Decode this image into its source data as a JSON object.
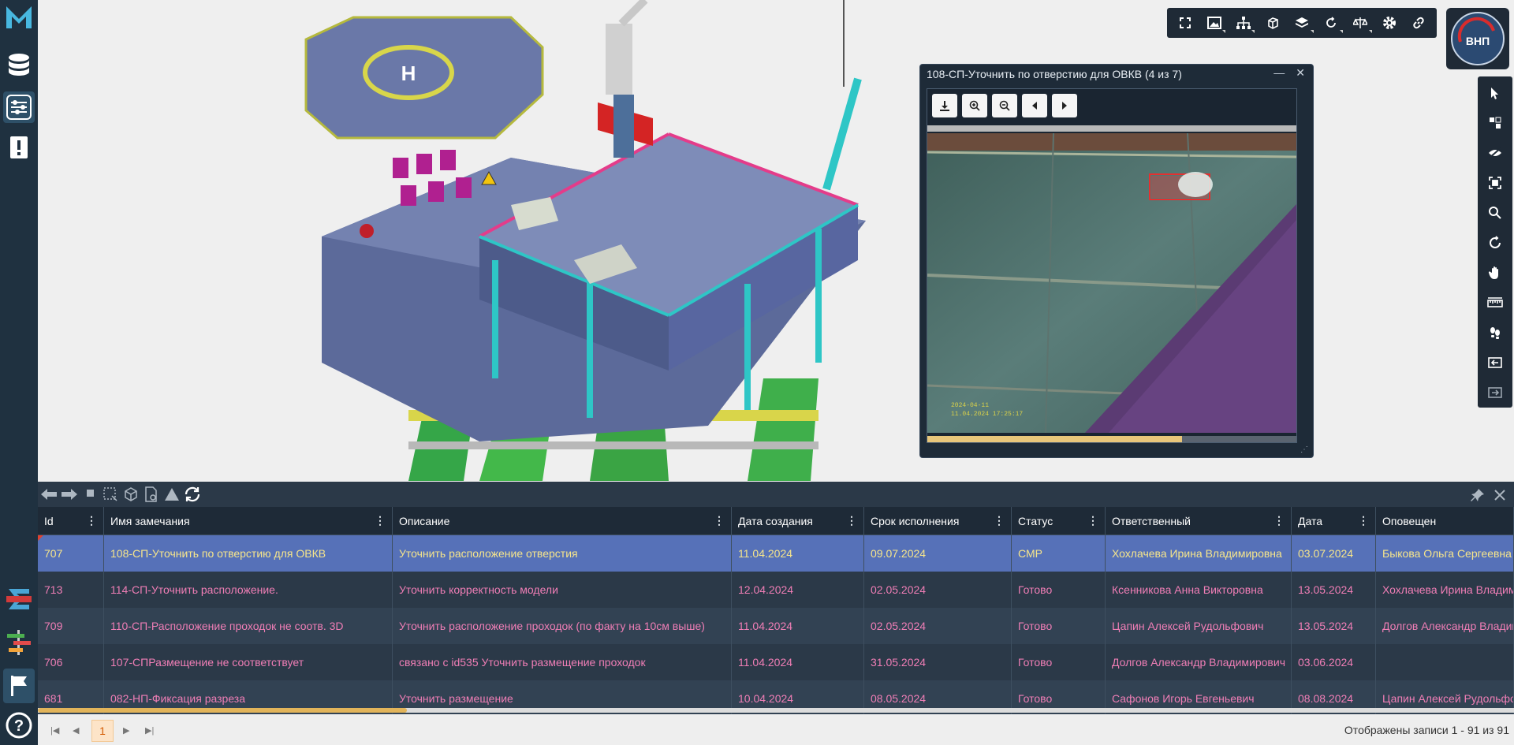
{
  "window": {
    "title": "108-СП-Уточнить по отверстию для ОВКВ (4 из 7)",
    "photo_stamp_line1": "2024-04-11",
    "photo_stamp_line2": "11.04.2024 17:25:17",
    "photo_progress": 0.69
  },
  "logo": {
    "text": "ВНП"
  },
  "sidebar": {
    "items": [
      {
        "icon": "logo-m-icon"
      },
      {
        "icon": "database-icon"
      },
      {
        "icon": "filter-sliders-icon"
      },
      {
        "icon": "issues-book-icon"
      },
      {
        "icon": "sigma-layers-icon"
      },
      {
        "icon": "gantt-icon"
      },
      {
        "icon": "flag-icon"
      },
      {
        "icon": "help-icon",
        "label": "?"
      }
    ]
  },
  "top_toolbar": {
    "items": [
      "fullscreen-icon",
      "image-icon",
      "hierarchy-icon",
      "cube-icon",
      "layers-icon",
      "rotate-icon",
      "scales-icon",
      "settings-icon",
      "link-icon"
    ]
  },
  "right_toolbar": {
    "items": [
      "select-cursor-icon",
      "select-box-icon",
      "hide-icon",
      "fit-view-icon",
      "search-zoom-icon",
      "orbit-icon",
      "pan-hand-icon",
      "measure-icon",
      "walk-icon",
      "section-in-icon",
      "section-out-icon"
    ]
  },
  "grid": {
    "columns": [
      "Id",
      "Имя замечания",
      "Описание",
      "Дата создания",
      "Срок исполнения",
      "Статус",
      "Ответственный",
      "Дата",
      "Оповещен"
    ],
    "rows": [
      [
        "707",
        "108-СП-Уточнить по отверстию для ОВКВ",
        "Уточнить расположение отверстия",
        "11.04.2024",
        "09.07.2024",
        "СМР",
        "Хохлачева Ирина Владимировна",
        "03.07.2024",
        "Быкова Ольга Сергеевна"
      ],
      [
        "713",
        "114-СП-Уточнить расположение.",
        "Уточнить корректность модели",
        "12.04.2024",
        "02.05.2024",
        "Готово",
        "Ксенникова Анна Викторовна",
        "13.05.2024",
        "Хохлачева Ирина Владимировна"
      ],
      [
        "709",
        "110-СП-Расположение проходок не соотв. 3D",
        "Уточнить расположение проходок (по факту на 10см выше)",
        "11.04.2024",
        "02.05.2024",
        "Готово",
        "Цапин Алексей Рудольфович",
        "13.05.2024",
        "Долгов Александр Владимирович"
      ],
      [
        "706",
        "107-СПРазмещение не соответствует",
        "связано с id535 Уточнить размещение проходок",
        "11.04.2024",
        "31.05.2024",
        "Готово",
        "Долгов Александр Владимирович",
        "03.06.2024",
        ""
      ],
      [
        "681",
        "082-НП-Фиксация разреза",
        "Уточнить размещение",
        "10.04.2024",
        "08.05.2024",
        "Готово",
        "Сафонов Игорь Евгеньевич",
        "08.08.2024",
        "Цапин Алексей Рудольфович"
      ]
    ],
    "selected_row": 0,
    "horizontal_scroll": 0.25
  },
  "pager": {
    "current_page": "1",
    "info": "Отображены записи 1 - 91 из 91"
  }
}
